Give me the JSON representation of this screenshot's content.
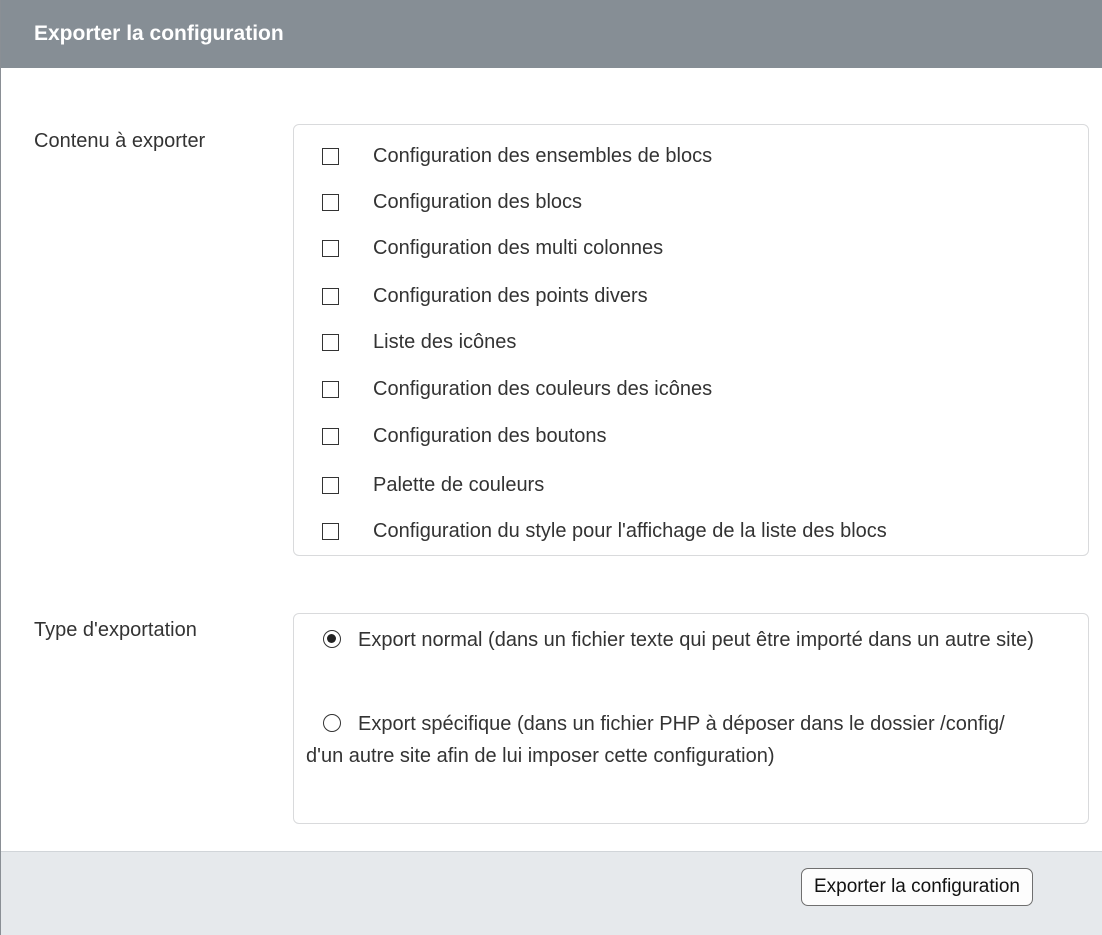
{
  "panel": {
    "title": "Exporter la configuration"
  },
  "content_section": {
    "label": "Contenu à exporter",
    "options": [
      {
        "label": "Configuration des ensembles de blocs",
        "checked": false
      },
      {
        "label": "Configuration des blocs",
        "checked": false
      },
      {
        "label": "Configuration des multi colonnes",
        "checked": false
      },
      {
        "label": "Configuration des points divers",
        "checked": false
      },
      {
        "label": "Liste des icônes",
        "checked": false
      },
      {
        "label": "Configuration des couleurs des icônes",
        "checked": false
      },
      {
        "label": "Configuration des boutons",
        "checked": false
      },
      {
        "label": "Palette de couleurs",
        "checked": false
      },
      {
        "label": "Configuration du style pour l'affichage de la liste des blocs",
        "checked": false
      }
    ]
  },
  "type_section": {
    "label": "Type d'exportation",
    "options": [
      {
        "label": "Export normal (dans un fichier texte qui peut être importé dans un autre site)",
        "selected": true
      },
      {
        "label": "Export spécifique (dans un fichier PHP à déposer dans le dossier /config/ d'un autre site afin de lui imposer cette configuration)",
        "selected": false
      }
    ]
  },
  "footer": {
    "export_button_label": "Exporter la configuration"
  },
  "colors": {
    "header_bg": "#868e95",
    "footer_bg": "#e6e9ec",
    "box_border": "#d9dadc"
  }
}
